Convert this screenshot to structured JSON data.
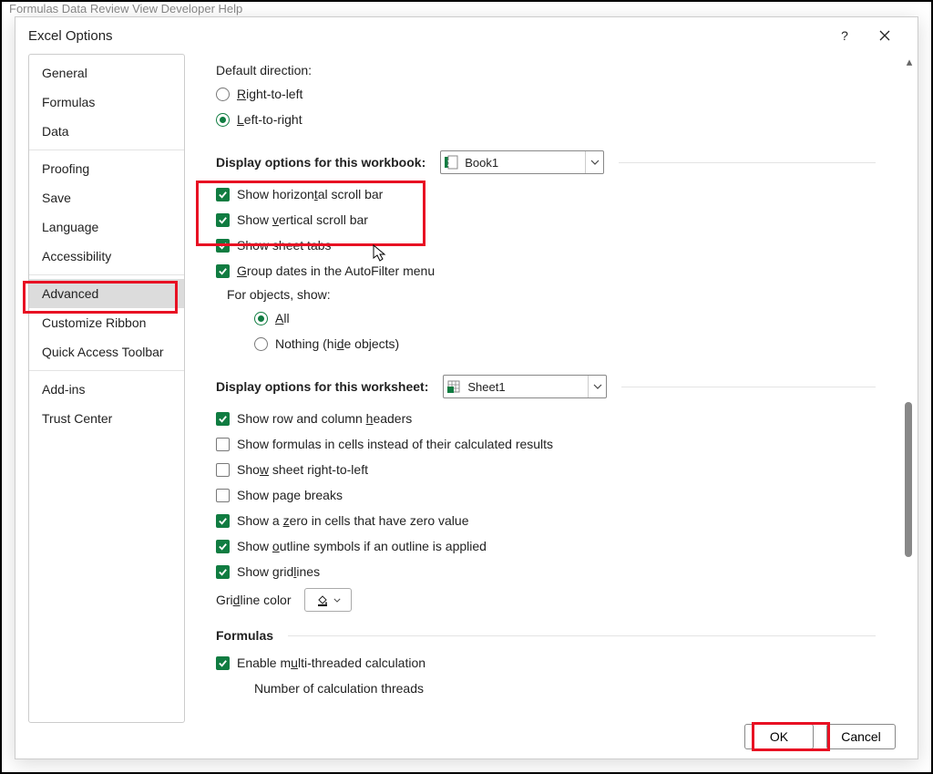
{
  "ribbon_hint": "Formulas    Data    Review    View    Developer    Help",
  "dialog_title": "Excel Options",
  "sidebar": {
    "items": [
      {
        "label": "General"
      },
      {
        "label": "Formulas"
      },
      {
        "label": "Data"
      },
      {
        "label": "Proofing"
      },
      {
        "label": "Save"
      },
      {
        "label": "Language"
      },
      {
        "label": "Accessibility"
      },
      {
        "label": "Advanced",
        "selected": true
      },
      {
        "label": "Customize Ribbon"
      },
      {
        "label": "Quick Access Toolbar"
      },
      {
        "label": "Add-ins"
      },
      {
        "label": "Trust Center"
      }
    ]
  },
  "default_direction": {
    "label": "Default direction:",
    "rtl": "Right-to-left",
    "ltr": "Left-to-right",
    "selected": "ltr"
  },
  "workbook_section": {
    "heading": "Display options for this workbook:",
    "selected": "Book1",
    "opts": {
      "h_scroll": "Show horizontal scroll bar",
      "v_scroll": "Show vertical scroll bar",
      "sheet_tabs": "Show sheet tabs",
      "group_dates": "Group dates in the AutoFilter menu"
    },
    "objects_label": "For objects, show:",
    "objects_all": "All",
    "objects_nothing": "Nothing (hide objects)",
    "objects_selected": "all"
  },
  "worksheet_section": {
    "heading": "Display options for this worksheet:",
    "selected": "Sheet1",
    "opts": {
      "headers": {
        "label": "Show row and column headers",
        "checked": true
      },
      "formulas": {
        "label": "Show formulas in cells instead of their calculated results",
        "checked": false
      },
      "rtl": {
        "label": "Show sheet right-to-left",
        "checked": false
      },
      "pagebreaks": {
        "label": "Show page breaks",
        "checked": false
      },
      "zero": {
        "label": "Show a zero in cells that have zero value",
        "checked": true
      },
      "outline": {
        "label": "Show outline symbols if an outline is applied",
        "checked": true
      },
      "gridlines": {
        "label": "Show gridlines",
        "checked": true
      }
    },
    "gridcolor_label": "Gridline color"
  },
  "formulas_section": {
    "heading": "Formulas",
    "multi": {
      "label": "Enable multi-threaded calculation",
      "checked": true
    },
    "threads_label": "Number of calculation threads"
  },
  "footer": {
    "ok": "OK",
    "cancel": "Cancel"
  }
}
